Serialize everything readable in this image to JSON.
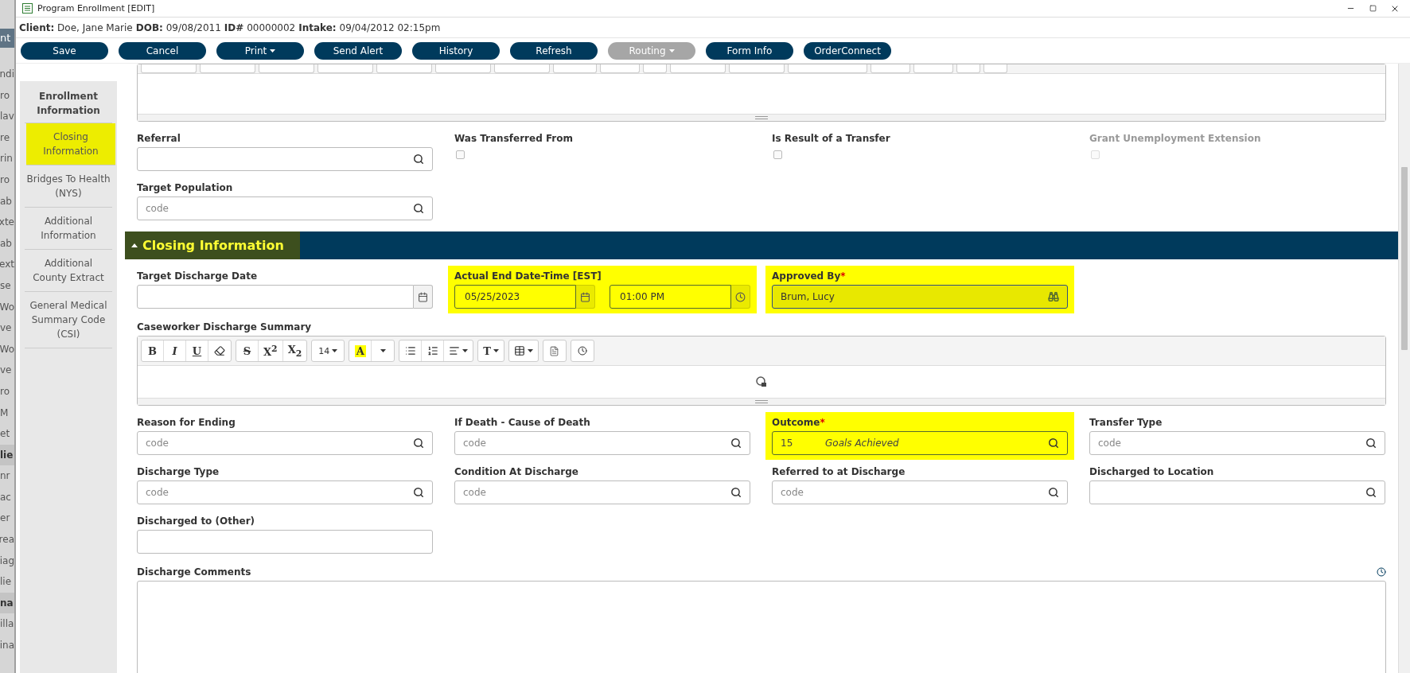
{
  "background_window": {
    "tab": "nt",
    "fragments": [
      {
        "text": "ndi",
        "kind": "item"
      },
      {
        "text": "ro",
        "kind": "item"
      },
      {
        "text": "lav",
        "kind": "item"
      },
      {
        "text": "re",
        "kind": "item"
      },
      {
        "text": "rin",
        "kind": "item"
      },
      {
        "text": "ro",
        "kind": "item"
      },
      {
        "text": "ab",
        "kind": "item"
      },
      {
        "text": "xte",
        "kind": "item"
      },
      {
        "text": "ab",
        "kind": "item"
      },
      {
        "text": "ext",
        "kind": "item"
      },
      {
        "text": "se",
        "kind": "item"
      },
      {
        "text": "Wo",
        "kind": "item"
      },
      {
        "text": "ve",
        "kind": "item"
      },
      {
        "text": "Wo",
        "kind": "item"
      },
      {
        "text": "ve",
        "kind": "item"
      },
      {
        "text": "ro",
        "kind": "item"
      },
      {
        "text": "M",
        "kind": "item"
      },
      {
        "text": "et",
        "kind": "item"
      },
      {
        "text": "lie",
        "kind": "header"
      },
      {
        "text": "nr",
        "kind": "item"
      },
      {
        "text": "ac",
        "kind": "item"
      },
      {
        "text": "er",
        "kind": "item"
      },
      {
        "text": "rea",
        "kind": "item"
      },
      {
        "text": "iag",
        "kind": "item"
      },
      {
        "text": "lie",
        "kind": "item"
      },
      {
        "text": "na",
        "kind": "header"
      },
      {
        "text": "illa",
        "kind": "item"
      },
      {
        "text": "ina",
        "kind": "item"
      }
    ]
  },
  "window": {
    "title": "Program Enrollment [EDIT]"
  },
  "client_info": [
    {
      "label": "Client:",
      "value": "Doe, Jane Marie"
    },
    {
      "label": "DOB:",
      "value": "09/08/2011"
    },
    {
      "label": "ID#",
      "value": "00000002"
    },
    {
      "label": "Intake:",
      "value": "09/04/2012 02:15pm"
    }
  ],
  "toolbar": [
    {
      "label": "Save",
      "dropdown": false,
      "disabled": false
    },
    {
      "label": "Cancel",
      "dropdown": false,
      "disabled": false
    },
    {
      "label": "Print",
      "dropdown": true,
      "disabled": false
    },
    {
      "label": "Send Alert",
      "dropdown": false,
      "disabled": false
    },
    {
      "label": "History",
      "dropdown": false,
      "disabled": false
    },
    {
      "label": "Refresh",
      "dropdown": false,
      "disabled": false
    },
    {
      "label": "Routing",
      "dropdown": true,
      "disabled": true
    },
    {
      "label": "Form Info",
      "dropdown": false,
      "disabled": false
    },
    {
      "label": "OrderConnect",
      "dropdown": false,
      "disabled": false
    }
  ],
  "sidebar": {
    "heading": "Enrollment Information",
    "items": [
      {
        "label": "Closing Information",
        "selected": true
      },
      {
        "label": "Bridges To Health (NYS)",
        "selected": false
      },
      {
        "label": "Additional Information",
        "selected": false
      },
      {
        "label": "Additional County Extract",
        "selected": false
      },
      {
        "label": "General Medical Summary Code (CSI)",
        "selected": false
      }
    ]
  },
  "upper_rows": [
    [
      {
        "kind": "lookup",
        "label": "Referral"
      },
      {
        "kind": "checkbox",
        "label": "Was Transferred From",
        "checked": false,
        "disabled": false
      },
      {
        "kind": "checkbox",
        "label": "Is Result of a Transfer",
        "checked": false,
        "disabled": false
      },
      {
        "kind": "checkbox",
        "label": "Grant Unemployment Extension",
        "checked": false,
        "disabled": true
      }
    ],
    [
      {
        "kind": "lookup",
        "label": "Target Population",
        "placeholder": "code"
      }
    ]
  ],
  "section": {
    "title": "Closing Information",
    "expanded": true,
    "highlighted": true
  },
  "closing_rows": [
    [
      {
        "kind": "date",
        "label": "Target Discharge Date"
      },
      {
        "kind": "datetime",
        "label": "Actual End Date-Time [EST]",
        "date_value": "05/25/2023",
        "time_value": "01:00 PM",
        "highlighted": true
      },
      {
        "kind": "person_lookup",
        "label": "Approved By",
        "required_mark": "*",
        "value": "Brum, Lucy",
        "highlighted": true
      }
    ]
  ],
  "summary_editor": {
    "label": "Caseworker Discharge Summary",
    "toolbar": [
      [
        {
          "kind": "bold",
          "label": "B"
        },
        {
          "kind": "italic",
          "label": "I"
        },
        {
          "kind": "underline",
          "label": "U"
        },
        {
          "kind": "eraser"
        }
      ],
      [
        {
          "kind": "strike",
          "label": "S"
        },
        {
          "kind": "script",
          "label": "X$^{2}$"
        },
        {
          "kind": "script",
          "label": "X$_{2}$"
        }
      ],
      [
        {
          "kind": "fontsize",
          "label": "14"
        }
      ],
      [
        {
          "kind": "color",
          "label": "A"
        },
        {
          "kind": "caret"
        }
      ],
      [
        {
          "kind": "bullets"
        },
        {
          "kind": "numbers"
        },
        {
          "kind": "align"
        }
      ],
      [
        {
          "kind": "textsize",
          "label": "T"
        }
      ],
      [
        {
          "kind": "table"
        }
      ],
      [
        {
          "kind": "document"
        }
      ],
      [
        {
          "kind": "clock"
        }
      ]
    ]
  },
  "lower_rows": [
    [
      {
        "kind": "lookup",
        "label": "Reason for Ending",
        "placeholder": "code"
      },
      {
        "kind": "lookup",
        "label": "If Death - Cause of Death",
        "placeholder": "code"
      },
      {
        "kind": "coded",
        "label": "Outcome",
        "required_mark": "*",
        "code": "15",
        "description": "Goals Achieved",
        "highlighted": true
      },
      {
        "kind": "lookup",
        "label": "Transfer Type",
        "placeholder": "code"
      }
    ],
    [
      {
        "kind": "lookup",
        "label": "Discharge Type",
        "placeholder": "code"
      },
      {
        "kind": "lookup",
        "label": "Condition At Discharge",
        "placeholder": "code"
      },
      {
        "kind": "lookup",
        "label": "Referred to at Discharge",
        "placeholder": "code"
      },
      {
        "kind": "lookup",
        "label": "Discharged to Location"
      }
    ],
    [
      {
        "kind": "text",
        "label": "Discharged to (Other)"
      }
    ]
  ],
  "comments": {
    "label": "Discharge Comments"
  }
}
